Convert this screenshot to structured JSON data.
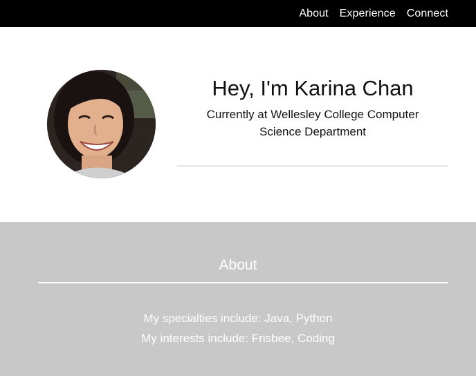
{
  "nav": {
    "items": [
      {
        "label": "About"
      },
      {
        "label": "Experience"
      },
      {
        "label": "Connect"
      }
    ]
  },
  "hero": {
    "title": "Hey, I'm Karina Chan",
    "subtitle": "Currently at Wellesley College Computer Science Department",
    "avatar_icon": "profile-photo"
  },
  "about": {
    "title": "About",
    "specialties": "My specialties include: Java, Python",
    "interests": "My interests include: Frisbee, Coding"
  },
  "colors": {
    "navbar": "#000000",
    "about_background": "#c8c8c8",
    "text_dark": "#111111",
    "text_light": "#ffffff"
  }
}
